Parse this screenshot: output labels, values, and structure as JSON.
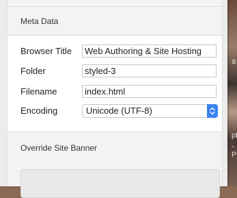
{
  "meta_section": {
    "title": "Meta Data",
    "browser_title_label": "Browser Title",
    "browser_title_value": "Web Authoring & Site Hosting",
    "folder_label": "Folder",
    "folder_value": "styled-3",
    "filename_label": "Filename",
    "filename_value": "index.html",
    "encoding_label": "Encoding",
    "encoding_value": "Unicode (UTF-8)"
  },
  "override_section": {
    "title": "Override Site Banner"
  },
  "desktop_fragments": [
    "a",
    "pt",
    "-P"
  ],
  "colors": {
    "accent": "#3b82f0",
    "panel_bg": "#f3f3f3",
    "field_border": "#c6c6c6"
  },
  "icons": {
    "encoding_select": "up-down-chevron-icon"
  }
}
